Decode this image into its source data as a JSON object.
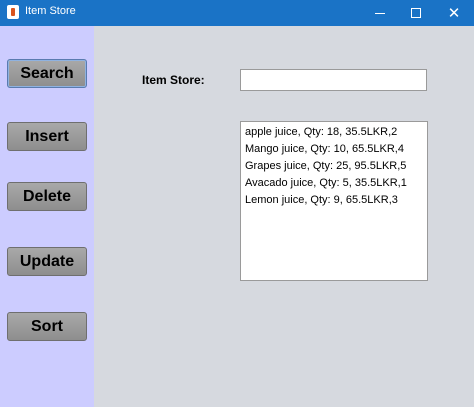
{
  "window": {
    "title": "Item Store",
    "minimize_glyph": "",
    "close_glyph": "✕"
  },
  "sidebar": {
    "buttons": [
      {
        "label": "Search"
      },
      {
        "label": "Insert"
      },
      {
        "label": "Delete"
      },
      {
        "label": "Update"
      },
      {
        "label": "Sort"
      }
    ]
  },
  "main": {
    "field_label": "Item Store:",
    "search_value": "",
    "items": [
      "apple juice, Qty: 18, 35.5LKR,2",
      "Mango juice, Qty: 10, 65.5LKR,4",
      "Grapes juice, Qty: 25, 95.5LKR,5",
      "Avacado juice, Qty: 5, 35.5LKR,1",
      "Lemon juice, Qty: 9, 65.5LKR,3"
    ]
  },
  "colors": {
    "titlebar": "#1a73c6",
    "sidebar": "#ccccff",
    "background": "#d6d9df",
    "button": "#9a9a9a"
  }
}
